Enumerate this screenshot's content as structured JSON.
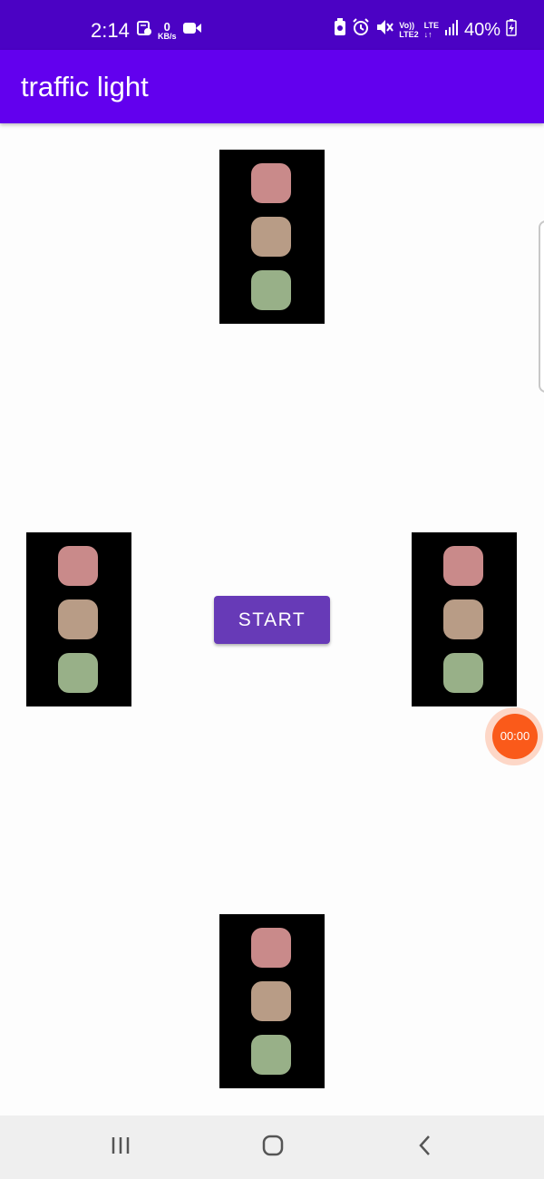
{
  "status_bar": {
    "time": "2:14",
    "data_rate": "0",
    "data_unit": "KB/s",
    "net_top": "Vo))",
    "net_bottom": "LTE2",
    "lte_label": "LTE",
    "battery": "40%",
    "icons": [
      "screenshot-icon",
      "video-icon",
      "battery-saver-icon",
      "alarm-icon",
      "mute-icon",
      "signal-icon",
      "charging-icon"
    ]
  },
  "app_bar": {
    "title": "traffic light"
  },
  "traffic_lights": [
    {
      "position": "top",
      "lamps": [
        "red",
        "yellow",
        "green"
      ]
    },
    {
      "position": "left",
      "lamps": [
        "red",
        "yellow",
        "green"
      ]
    },
    {
      "position": "right",
      "lamps": [
        "red",
        "yellow",
        "green"
      ]
    },
    {
      "position": "bottom",
      "lamps": [
        "red",
        "yellow",
        "green"
      ]
    }
  ],
  "lamp_colors": {
    "red": "#c98a8a",
    "yellow": "#b89c86",
    "green": "#98b088"
  },
  "start_button": {
    "label": "START"
  },
  "recorder": {
    "time": "00:00"
  },
  "nav_bar": {
    "buttons": [
      "recent-apps-icon",
      "home-icon",
      "back-icon"
    ]
  },
  "colors": {
    "status_bar": "#4b02c4",
    "app_bar": "#6200ee",
    "button": "#673ab7",
    "recorder": "#fa5a1a"
  }
}
